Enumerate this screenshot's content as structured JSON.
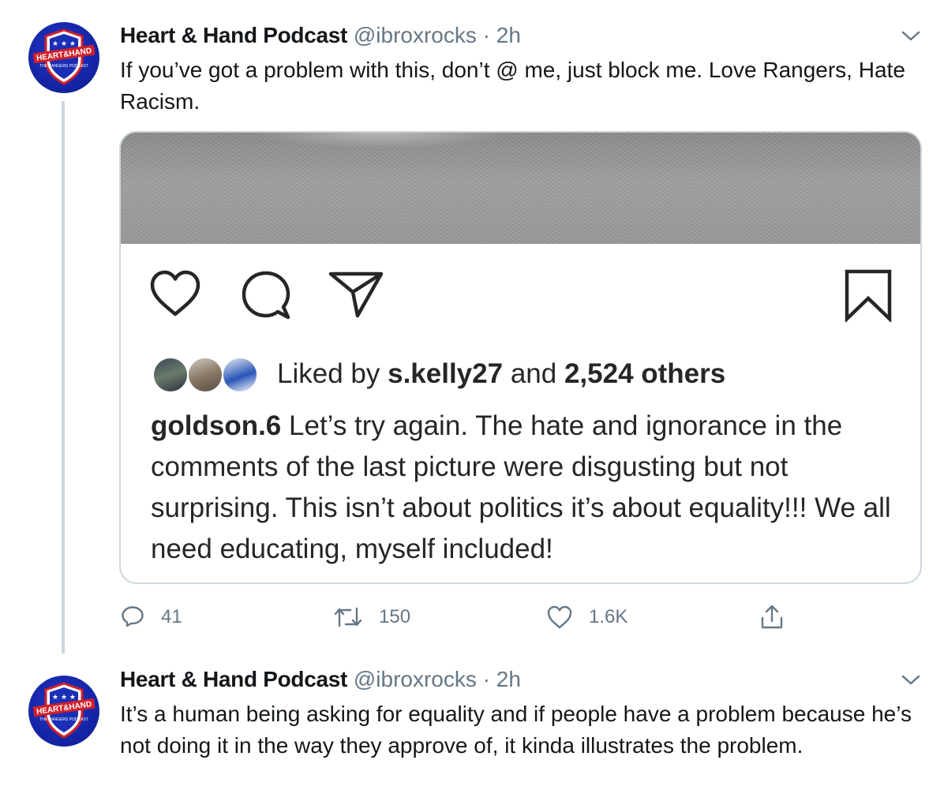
{
  "tweets": [
    {
      "display_name": "Heart & Hand Podcast",
      "handle": "@ibroxrocks",
      "separator": "·",
      "time": "2h",
      "text": "If you’ve got a problem with this, don’t @ me, just block me. Love Rangers, Hate Racism.",
      "avatar": {
        "top_text": "HEART&HAND",
        "sub_text": "THE RANGERS PODCAST"
      },
      "embedded_post": {
        "liked_prefix": "Liked by",
        "liked_user": "s.kelly27",
        "liked_and": "and",
        "liked_others": "2,524 others",
        "caption_user": "goldson.6",
        "caption_text": "Let’s try again. The hate and ignorance in the comments of the last picture were disgusting but not surprising. This isn’t about politics it’s about equality!!! We all need educating, myself included!"
      },
      "actions": {
        "replies": "41",
        "retweets": "150",
        "likes": "1.6K"
      }
    },
    {
      "display_name": "Heart & Hand Podcast",
      "handle": "@ibroxrocks",
      "separator": "·",
      "time": "2h",
      "text": "It’s a human being asking for equality and if people have a problem because he’s not doing it in the way they approve of, it kinda illustrates the problem.",
      "avatar": {
        "top_text": "HEART&HAND",
        "sub_text": "THE RANGERS PODCAST"
      }
    }
  ],
  "colors": {
    "text_primary": "#14171a",
    "text_secondary": "#657786",
    "border": "#ccd6dd",
    "avatar_blue": "#1525a6",
    "avatar_red": "#d0202a"
  }
}
